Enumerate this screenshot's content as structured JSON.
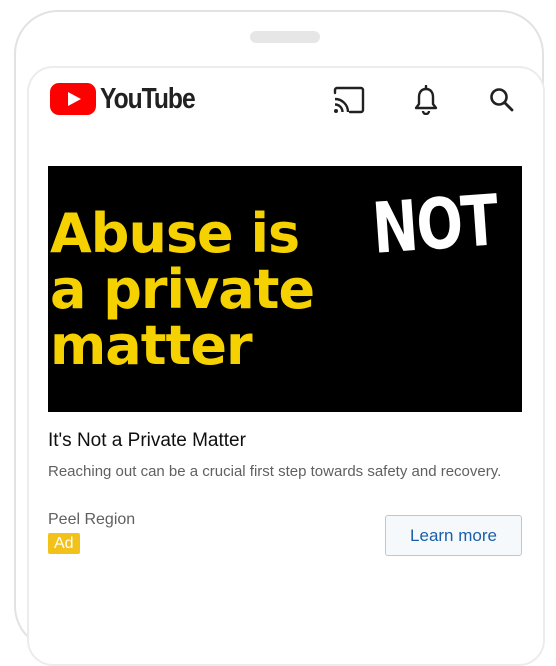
{
  "header": {
    "app_name": "YouTube",
    "brand_color": "#ff0000",
    "icons": [
      "cast-icon",
      "bell-icon",
      "search-icon"
    ]
  },
  "ad": {
    "image": {
      "headline_lines": [
        "Abuse is",
        "a private",
        "matter"
      ],
      "headline_emphasis": "NOT",
      "background_color": "#000000",
      "headline_color": "#f5d100",
      "emphasis_color": "#ffffff"
    },
    "title": "It's Not a Private Matter",
    "description": "Reaching out can be a crucial first step towards safety and recovery.",
    "advertiser": "Peel Region",
    "badge": "Ad",
    "badge_color": "#f2c21b",
    "cta_label": "Learn more",
    "cta_color": "#1a5fa8"
  }
}
